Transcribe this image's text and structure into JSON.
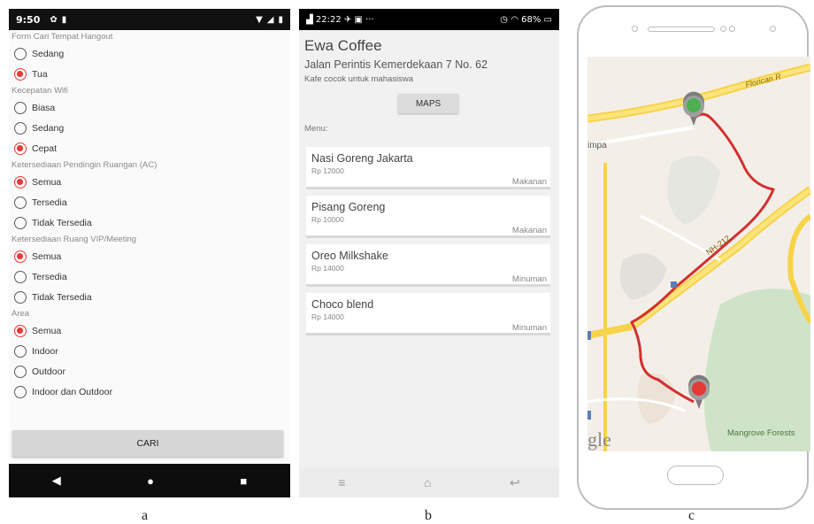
{
  "panel_a": {
    "status_time": "9:50",
    "form_title": "Form Cari Tempat Hangout",
    "groups": [
      {
        "label": "",
        "options": [
          {
            "label": "Sedang",
            "checked": false
          },
          {
            "label": "Tua",
            "checked": true
          }
        ]
      },
      {
        "label": "Kecepatan Wifi",
        "options": [
          {
            "label": "Biasa",
            "checked": false
          },
          {
            "label": "Sedang",
            "checked": false
          },
          {
            "label": "Cepat",
            "checked": true
          }
        ]
      },
      {
        "label": "Ketersediaan Pendingin Ruangan (AC)",
        "options": [
          {
            "label": "Semua",
            "checked": true
          },
          {
            "label": "Tersedia",
            "checked": false
          },
          {
            "label": "Tidak Tersedia",
            "checked": false
          }
        ]
      },
      {
        "label": "Ketersediaan Ruang VIP/Meeting",
        "options": [
          {
            "label": "Semua",
            "checked": true
          },
          {
            "label": "Tersedia",
            "checked": false
          },
          {
            "label": "Tidak Tersedia",
            "checked": false
          }
        ]
      },
      {
        "label": "Area",
        "options": [
          {
            "label": "Semua",
            "checked": true
          },
          {
            "label": "Indoor",
            "checked": false
          },
          {
            "label": "Outdoor",
            "checked": false
          },
          {
            "label": "Indoor dan Outdoor",
            "checked": false
          }
        ]
      }
    ],
    "search_button": "CARI",
    "nav": {
      "back": "◀",
      "home": "●",
      "recent": "■"
    },
    "accent_color": "#e53935"
  },
  "panel_b": {
    "status_left": "22:22",
    "status_right": "68%",
    "title": "Ewa Coffee",
    "address": "Jalan Perintis Kemerdekaan 7 No. 62",
    "description": "Kafe cocok untuk mahasiswa",
    "maps_button": "MAPS",
    "menu_label": "Menu:",
    "menu_items": [
      {
        "name": "Nasi Goreng Jakarta",
        "price": "Rp 12000",
        "category": "Makanan"
      },
      {
        "name": "Pisang Goreng",
        "price": "Rp 10000",
        "category": "Makanan"
      },
      {
        "name": "Oreo Milkshake",
        "price": "Rp 14000",
        "category": "Minuman"
      },
      {
        "name": "Choco blend",
        "price": "Rp 14000",
        "category": "Minuman"
      }
    ],
    "nav": {
      "menu": "≡",
      "home": "⌂",
      "back": "↩"
    }
  },
  "panel_c": {
    "map_labels": {
      "road_top": "Florican R",
      "road_mid": "NH-212",
      "left": "impa",
      "bottom_left": "gle",
      "park": "Mangrove Forests"
    },
    "start_pin_color": "#4caf50",
    "end_pin_color": "#e53935",
    "route_color": "#d32f2f"
  },
  "captions": {
    "a": "a",
    "b": "b",
    "c": "c"
  }
}
